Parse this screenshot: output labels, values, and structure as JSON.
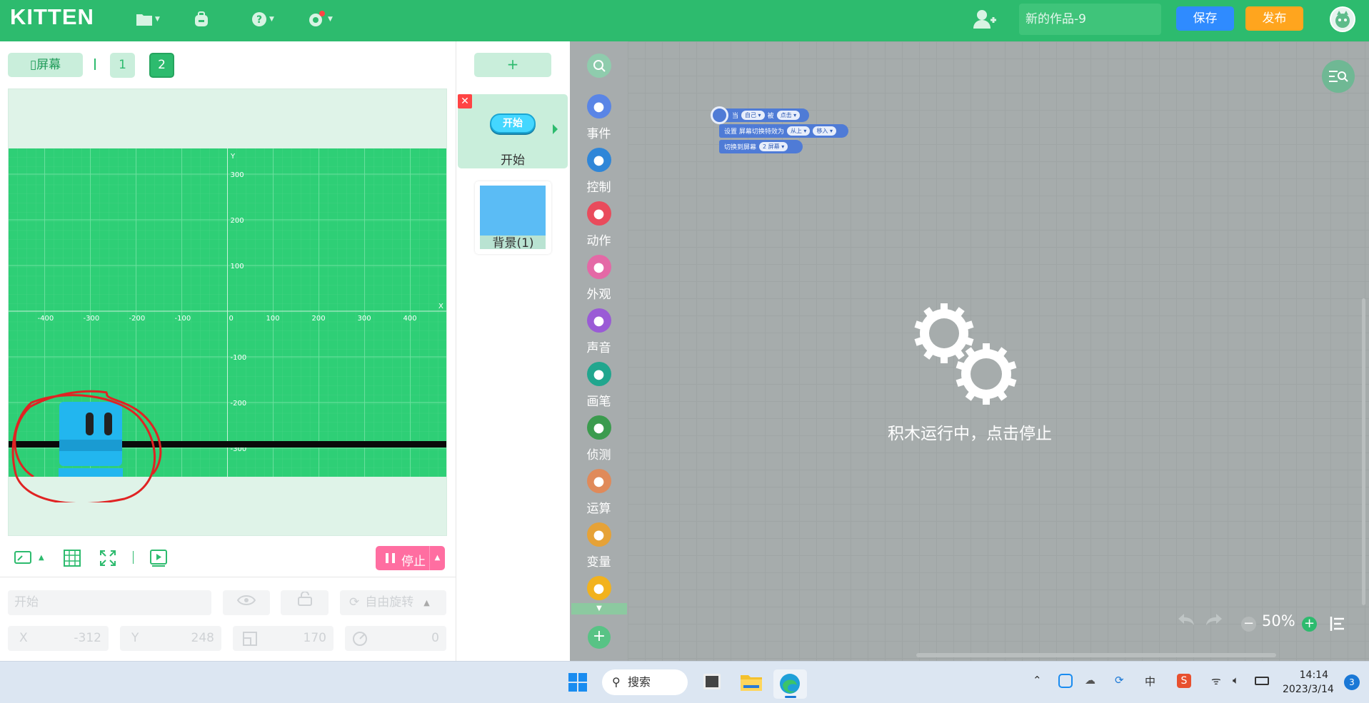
{
  "app": {
    "logo": "KITTEN",
    "project_name": "新的作品-9",
    "save_label": "保存",
    "publish_label": "发布"
  },
  "stage": {
    "screen_button": "屏幕",
    "screens": [
      "1",
      "2"
    ],
    "active_screen": "2",
    "x_ticks": [
      "-400",
      "-300",
      "-200",
      "-100",
      "0",
      "100",
      "200",
      "300",
      "400"
    ],
    "y_ticks": [
      "300",
      "200",
      "100",
      "-100",
      "-200",
      "-300"
    ],
    "x_axis_label": "X",
    "y_axis_label": "Y",
    "stop_label": "停止"
  },
  "props": {
    "name_placeholder": "开始",
    "rotation_label": "自由旋转",
    "x_label": "X",
    "x_value": "-312",
    "y_label": "Y",
    "y_value": "248",
    "size_value": "170",
    "direction_value": "0"
  },
  "sprites": {
    "add_label": "+",
    "start_pill": "开始",
    "start_label": "开始",
    "background_label": "背景(1)"
  },
  "categories": [
    {
      "label": "事件",
      "icon": "toggle-icon",
      "color": "#5a85e6"
    },
    {
      "label": "控制",
      "icon": "control-icon",
      "color": "#2f86d8"
    },
    {
      "label": "动作",
      "icon": "motion-icon",
      "color": "#e94b5c"
    },
    {
      "label": "外观",
      "icon": "shirt-icon",
      "color": "#e469a6"
    },
    {
      "label": "声音",
      "icon": "music-icon",
      "color": "#9a5bd6"
    },
    {
      "label": "画笔",
      "icon": "pen-icon",
      "color": "#21a68e"
    },
    {
      "label": "侦测",
      "icon": "sensor-icon",
      "color": "#3b9b4e"
    },
    {
      "label": "运算",
      "icon": "math-icon",
      "color": "#e08a5a"
    },
    {
      "label": "变量",
      "icon": "variable-icon",
      "color": "#e6a237"
    },
    {
      "label": "",
      "icon": "list-icon",
      "color": "#f2b21d"
    }
  ],
  "blocks": {
    "when": "当",
    "target": "自己",
    "is": "被",
    "event": "点击",
    "set_effect": "设置 屏幕切换特效为",
    "from": "从上",
    "move": "移入",
    "switch_to": "切换到屏幕",
    "screen_target": "2 屏幕"
  },
  "workspace": {
    "running_message": "积木运行中，点击停止",
    "zoom": "50%"
  },
  "taskbar": {
    "search_label": "搜索",
    "time": "14:14",
    "date": "2023/3/14",
    "notifications": "3",
    "ime_label": "中"
  }
}
